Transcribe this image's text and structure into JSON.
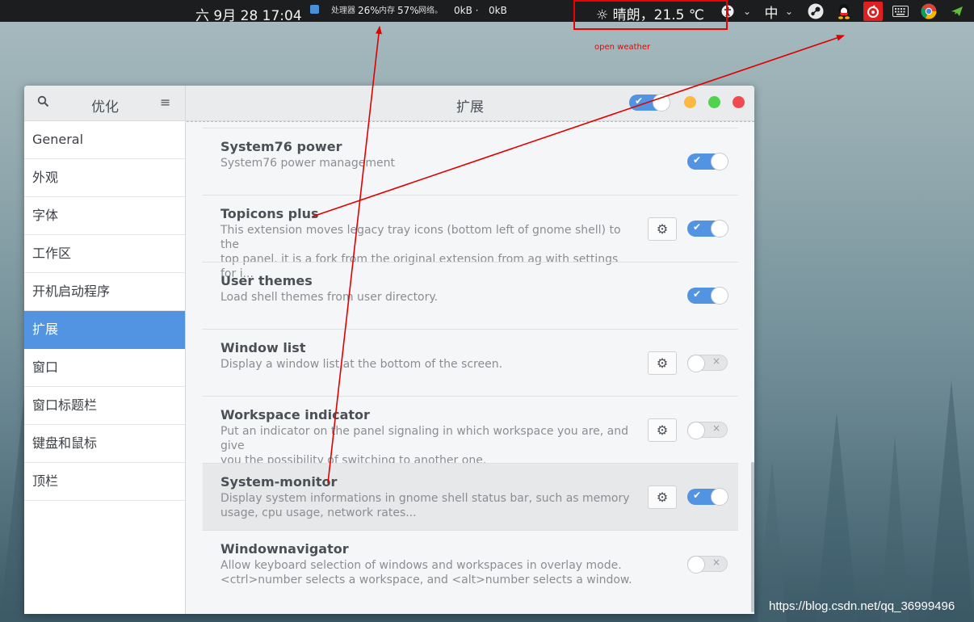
{
  "topbar": {
    "clock": "六 9月 28  17:04",
    "cpu_label": "处理器",
    "cpu_value": "26%",
    "mem_label": "内存",
    "mem_value": "57%",
    "net_label": "网络。",
    "net_down": "0kB ·",
    "net_up": "0kB",
    "weather": "☼ 晴朗，21.5 ℃",
    "ime": "中",
    "tray_icons": [
      "a11y-icon",
      "chevron-down-icon",
      "ime-icon",
      "steam-icon",
      "qq-icon",
      "netease-music-icon",
      "keyboard-icon",
      "chrome-icon",
      "telegram-icon"
    ]
  },
  "annotation": {
    "note": "open weather",
    "color": "#e00000"
  },
  "window": {
    "left_title": "优化",
    "title": "扩展",
    "sidebar": [
      {
        "label": "General",
        "active": false
      },
      {
        "label": "外观",
        "active": false
      },
      {
        "label": "字体",
        "active": false
      },
      {
        "label": "工作区",
        "active": false
      },
      {
        "label": "开机启动程序",
        "active": false
      },
      {
        "label": "扩展",
        "active": true
      },
      {
        "label": "窗口",
        "active": false
      },
      {
        "label": "窗口标题栏",
        "active": false
      },
      {
        "label": "键盘和鼠标",
        "active": false
      },
      {
        "label": "顶栏",
        "active": false
      }
    ],
    "extensions": [
      {
        "name": "System76 power",
        "desc": "System76 power management",
        "settings": false,
        "enabled": true
      },
      {
        "name": "Topicons plus",
        "desc": "This extension moves legacy tray icons (bottom left of gnome shell) to the\ntop panel. it is a fork from the original extension from ag  with settings for i...",
        "settings": true,
        "enabled": true
      },
      {
        "name": "User themes",
        "desc": "Load shell themes from user directory.",
        "settings": false,
        "enabled": true
      },
      {
        "name": "Window list",
        "desc": "Display a window list at the bottom of the screen.",
        "settings": true,
        "enabled": false
      },
      {
        "name": "Workspace indicator",
        "desc": "Put an indicator on the panel signaling in which workspace you are, and give\nyou the possibility of switching to another one.",
        "settings": true,
        "enabled": false
      },
      {
        "name": "System-monitor",
        "desc": "Display system informations in gnome shell status bar, such as memory\nusage, cpu usage, network rates...",
        "settings": true,
        "enabled": true
      },
      {
        "name": "Windownavigator",
        "desc": "Allow keyboard selection of windows and workspaces in overlay mode.\n<ctrl>number selects a workspace, and <alt>number selects a window.",
        "settings": false,
        "enabled": false
      }
    ]
  },
  "watermark": "https://blog.csdn.net/qq_36999496",
  "colors": {
    "accent": "#5294e2",
    "close": "#f04a50",
    "minimize": "#fbb942",
    "maximize": "#4dd34d"
  }
}
